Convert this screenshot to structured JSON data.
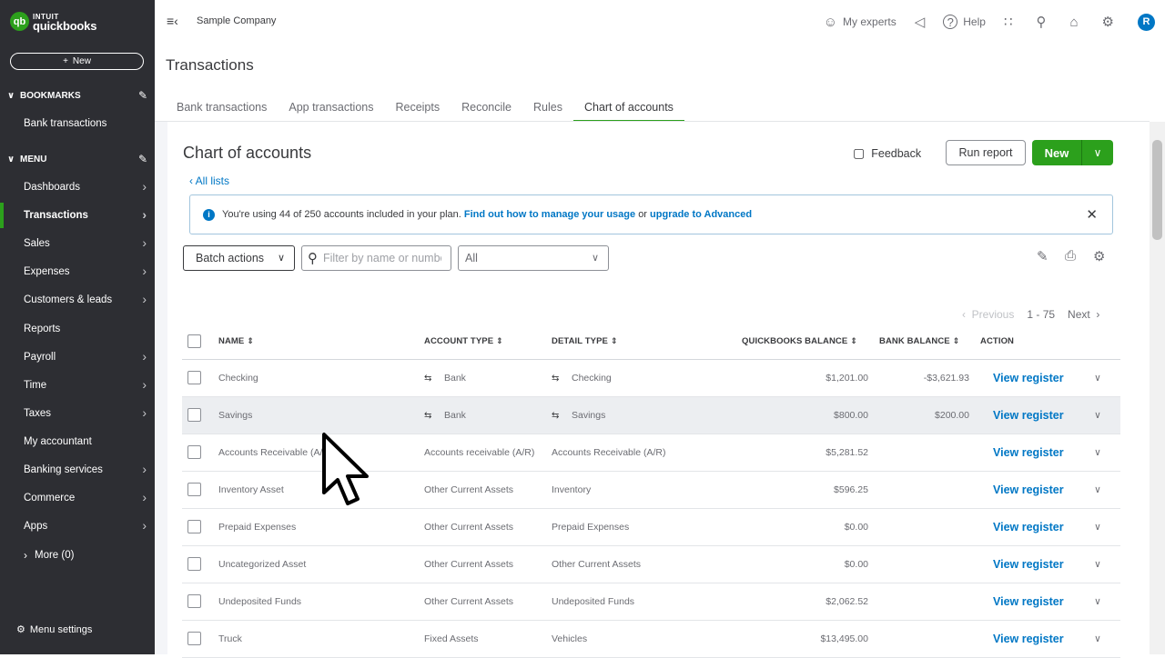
{
  "brand": {
    "top": "INTUIT",
    "bottom": "quickbooks",
    "mark": "qb",
    "green": "#2ca01c",
    "blue": "#0077c5"
  },
  "sidebar": {
    "new_label": "New",
    "bookmarks_label": "BOOKMARKS",
    "bookmarks": [
      "Bank transactions"
    ],
    "menu_label": "MENU",
    "items": [
      {
        "label": "Dashboards",
        "has_arrow": true
      },
      {
        "label": "Transactions",
        "has_arrow": true,
        "active": true
      },
      {
        "label": "Sales",
        "has_arrow": true
      },
      {
        "label": "Expenses",
        "has_arrow": true
      },
      {
        "label": "Customers & leads",
        "has_arrow": true
      },
      {
        "label": "Reports",
        "has_arrow": false
      },
      {
        "label": "Payroll",
        "has_arrow": true
      },
      {
        "label": "Time",
        "has_arrow": true
      },
      {
        "label": "Taxes",
        "has_arrow": true
      },
      {
        "label": "My accountant",
        "has_arrow": false
      },
      {
        "label": "Banking services",
        "has_arrow": true
      },
      {
        "label": "Commerce",
        "has_arrow": true
      },
      {
        "label": "Apps",
        "has_arrow": true
      }
    ],
    "more_label": "More (0)",
    "menu_settings": "Menu settings"
  },
  "topbar": {
    "company": "Sample Company",
    "my_experts": "My experts",
    "help": "Help",
    "avatar": "R"
  },
  "page": {
    "title": "Transactions",
    "tabs": [
      "Bank transactions",
      "App transactions",
      "Receipts",
      "Reconcile",
      "Rules",
      "Chart of accounts"
    ],
    "active_tab": "Chart of accounts"
  },
  "coa": {
    "title": "Chart of accounts",
    "all_lists": "All lists",
    "feedback": "Feedback",
    "run_report": "Run report",
    "new": "New",
    "banner": {
      "text": "You're using 44 of 250 accounts included in your plan.",
      "link1": "Find out how to manage your usage",
      "or": "or",
      "link2": "upgrade to Advanced"
    },
    "batch_actions": "Batch actions",
    "filter_placeholder": "Filter by name or number",
    "type_filter": "All",
    "pager": {
      "previous": "Previous",
      "range": "1 - 75",
      "next": "Next"
    },
    "columns": {
      "name": "NAME",
      "account_type": "ACCOUNT TYPE",
      "detail_type": "DETAIL TYPE",
      "qb_balance": "QUICKBOOKS BALANCE",
      "bank_balance": "BANK BALANCE",
      "action": "ACTION"
    },
    "action_label": "View register",
    "rows": [
      {
        "name": "Checking",
        "account_type": "Bank",
        "detail_type": "Checking",
        "qb_balance": "$1,201.00",
        "bank_balance": "-$3,621.93",
        "bank_icon": true
      },
      {
        "name": "Savings",
        "account_type": "Bank",
        "detail_type": "Savings",
        "qb_balance": "$800.00",
        "bank_balance": "$200.00",
        "bank_icon": true,
        "highlight": true
      },
      {
        "name": "Accounts Receivable (A/R)",
        "account_type": "Accounts receivable (A/R)",
        "detail_type": "Accounts Receivable (A/R)",
        "qb_balance": "$5,281.52",
        "bank_balance": ""
      },
      {
        "name": "Inventory Asset",
        "account_type": "Other Current Assets",
        "detail_type": "Inventory",
        "qb_balance": "$596.25",
        "bank_balance": ""
      },
      {
        "name": "Prepaid Expenses",
        "account_type": "Other Current Assets",
        "detail_type": "Prepaid Expenses",
        "qb_balance": "$0.00",
        "bank_balance": ""
      },
      {
        "name": "Uncategorized Asset",
        "account_type": "Other Current Assets",
        "detail_type": "Other Current Assets",
        "qb_balance": "$0.00",
        "bank_balance": ""
      },
      {
        "name": "Undeposited Funds",
        "account_type": "Other Current Assets",
        "detail_type": "Undeposited Funds",
        "qb_balance": "$2,062.52",
        "bank_balance": ""
      },
      {
        "name": "Truck",
        "account_type": "Fixed Assets",
        "detail_type": "Vehicles",
        "qb_balance": "$13,495.00",
        "bank_balance": ""
      }
    ]
  }
}
